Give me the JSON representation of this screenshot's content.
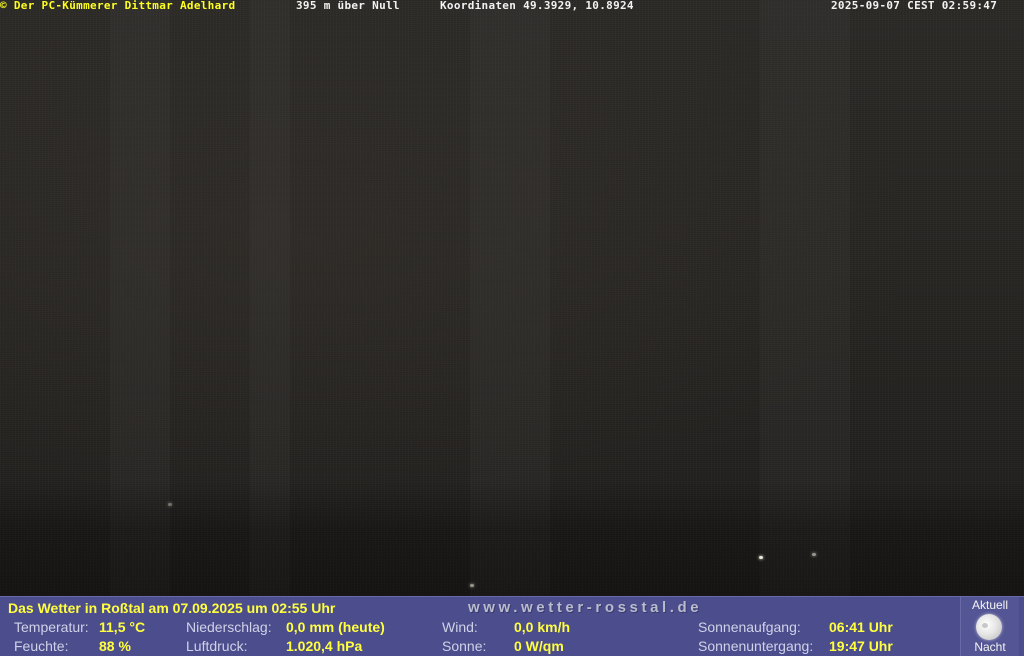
{
  "overlay": {
    "copyright": "© Der PC-Kümmerer Dittmar Adelhard",
    "altitude": "395 m über Null",
    "coordinates": "Koordinaten 49.3929, 10.8924",
    "timestamp": "2025-09-07 CEST 02:59:47"
  },
  "weather": {
    "title": "Das Wetter in Roßtal am 07.09.2025 um 02:55 Uhr",
    "url": "www.wetter-rosstal.de",
    "temperature": {
      "label": "Temperatur:",
      "value": "11,5 °C"
    },
    "humidity": {
      "label": "Feuchte:",
      "value": "88 %"
    },
    "precipitation": {
      "label": "Niederschlag:",
      "value": "0,0 mm (heute)"
    },
    "pressure": {
      "label": "Luftdruck:",
      "value": "1.020,4 hPa"
    },
    "wind": {
      "label": "Wind:",
      "value": "0,0 km/h"
    },
    "sun": {
      "label": "Sonne:",
      "value": "0 W/qm"
    },
    "sunrise": {
      "label": "Sonnenaufgang:",
      "value": "06:41 Uhr"
    },
    "sunset": {
      "label": "Sonnenuntergang:",
      "value": "19:47 Uhr"
    },
    "moon": {
      "top_label": "Aktuell",
      "bottom_label": "Nacht",
      "icon": "moon-icon"
    }
  },
  "colors": {
    "panel_background": "#4c4d8c",
    "value_text": "#ffff40",
    "label_text": "#d0d2e8"
  }
}
